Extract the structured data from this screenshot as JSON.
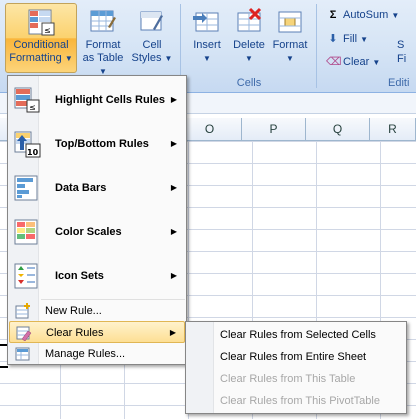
{
  "ribbon": {
    "conditional_formatting": {
      "line1": "Conditional",
      "line2": "Formatting"
    },
    "format_as_table": {
      "line1": "Format",
      "line2": "as Table"
    },
    "cell_styles": {
      "line1": "Cell",
      "line2": "Styles"
    },
    "insert": {
      "label": "Insert"
    },
    "delete": {
      "label": "Delete"
    },
    "format": {
      "label": "Format"
    },
    "cells_group_label": "Cells",
    "autosum": {
      "label": "AutoSum"
    },
    "fill": {
      "label": "Fill"
    },
    "clear": {
      "label": "Clear"
    },
    "editing_group_label": "Editi",
    "sort_partial": "S",
    "filter_partial": "Fi"
  },
  "sheet": {
    "columns": [
      "O",
      "P",
      "Q",
      "R"
    ]
  },
  "menu": {
    "items": [
      {
        "label": "Highlight Cells Rules",
        "icon": "highlight-cells-icon",
        "has_submenu": true
      },
      {
        "label": "Top/Bottom Rules",
        "icon": "top-bottom-icon",
        "has_submenu": true
      },
      {
        "label": "Data Bars",
        "icon": "data-bars-icon",
        "has_submenu": true
      },
      {
        "label": "Color Scales",
        "icon": "color-scales-icon",
        "has_submenu": true
      },
      {
        "label": "Icon Sets",
        "icon": "icon-sets-icon",
        "has_submenu": true
      }
    ],
    "new_rule": "New Rule...",
    "clear_rules": "Clear Rules",
    "manage_rules": "Manage Rules..."
  },
  "submenu": {
    "items": [
      {
        "label": "Clear Rules from Selected Cells",
        "enabled": true
      },
      {
        "label": "Clear Rules from Entire Sheet",
        "enabled": true
      },
      {
        "label": "Clear Rules from This Table",
        "enabled": false
      },
      {
        "label": "Clear Rules from This PivotTable",
        "enabled": false
      }
    ]
  },
  "colors": {
    "ribbon_bg": "#d5e4f5",
    "active_button": "#fbd26e",
    "menu_hover": "#fddf94",
    "ribbon_text": "#15428b",
    "disabled_text": "#a7a7a7"
  }
}
